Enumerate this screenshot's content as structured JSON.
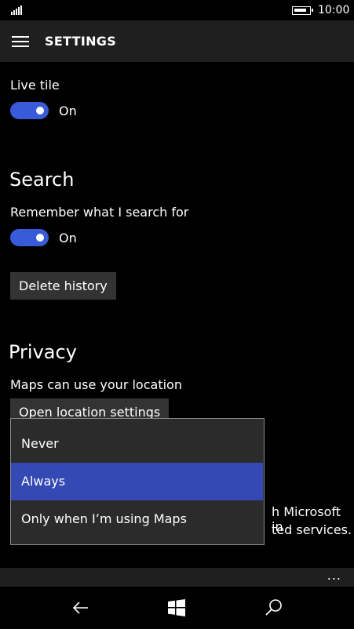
{
  "status": {
    "time": "10:00"
  },
  "header": {
    "title": "SETTINGS"
  },
  "live_tile": {
    "label": "Live tile",
    "state": "On"
  },
  "search": {
    "title": "Search",
    "remember_label": "Remember what I search for",
    "state": "On",
    "delete_button": "Delete history"
  },
  "privacy": {
    "title": "Privacy",
    "location_label": "Maps can use your location",
    "location_button": "Open location settings",
    "partial_line_1": "h Microsoft in",
    "partial_line_2": "ted services."
  },
  "location_dropdown": {
    "options": [
      "Never",
      "Always",
      "Only when I’m using Maps"
    ],
    "selected": "Always"
  },
  "app_bar": {
    "more": "..."
  },
  "colors": {
    "accent": "#3a5bd9",
    "selected": "#3449b3"
  }
}
